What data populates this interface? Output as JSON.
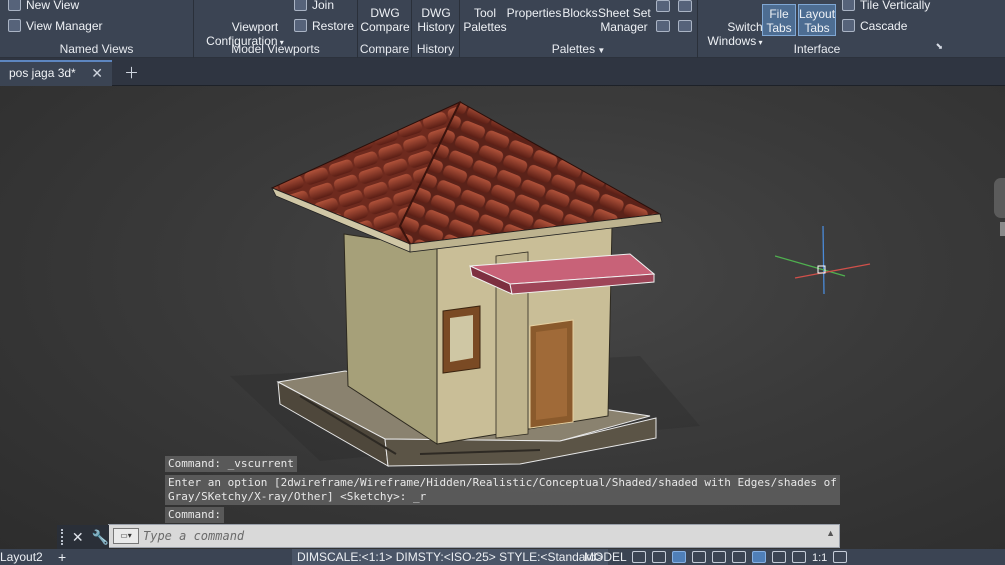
{
  "ribbon": {
    "named_views": {
      "title": "Named Views",
      "new_view": "New View",
      "view_manager": "View Manager"
    },
    "model_viewports": {
      "title": "Model Viewports",
      "viewport_configuration": "Viewport\nConfiguration",
      "join": "Join",
      "restore": "Restore"
    },
    "compare": {
      "title": "Compare",
      "dwg_compare": "DWG\nCompare"
    },
    "history": {
      "title": "History",
      "dwg_history": "DWG\nHistory"
    },
    "palettes": {
      "title": "Palettes",
      "tool_palettes": "Tool\nPalettes",
      "properties": "Properties",
      "blocks": "Blocks",
      "sheet_set_manager": "Sheet Set\nManager"
    },
    "interface": {
      "title": "Interface",
      "switch_windows": "Switch\nWindows",
      "file_tabs": "File\nTabs",
      "layout_tabs": "Layout\nTabs",
      "tile_vertically": "Tile Vertically",
      "cascade": "Cascade"
    }
  },
  "doc_tabs": [
    {
      "label": "pos jaga 3d*"
    }
  ],
  "command_history": [
    "Command: _vscurrent",
    "Enter an option [2dwireframe/Wireframe/Hidden/Realistic/Conceptual/Shaded/shaded with Edges/shades of\nGray/SKetchy/X-ray/Other] <Sketchy>: _r",
    "Command:"
  ],
  "command_input": {
    "placeholder": "Type a command",
    "value": ""
  },
  "status": {
    "layout_tab": "Layout2",
    "dimscale": "DIMSCALE:<1:1> DIMSTY:<ISO-25> STYLE:<Standard>",
    "model": "MODEL",
    "annotation_scale": "1:1"
  },
  "colors": {
    "ribbon": "#3b4453",
    "active_button": "#4d6d92",
    "viewport_bg": "#3a3a3a",
    "roof": "#8b3a2a",
    "wall": "#c7bb95",
    "door": "#9a6a3a",
    "canopy": "#c45c74",
    "base": "#6b6354"
  }
}
